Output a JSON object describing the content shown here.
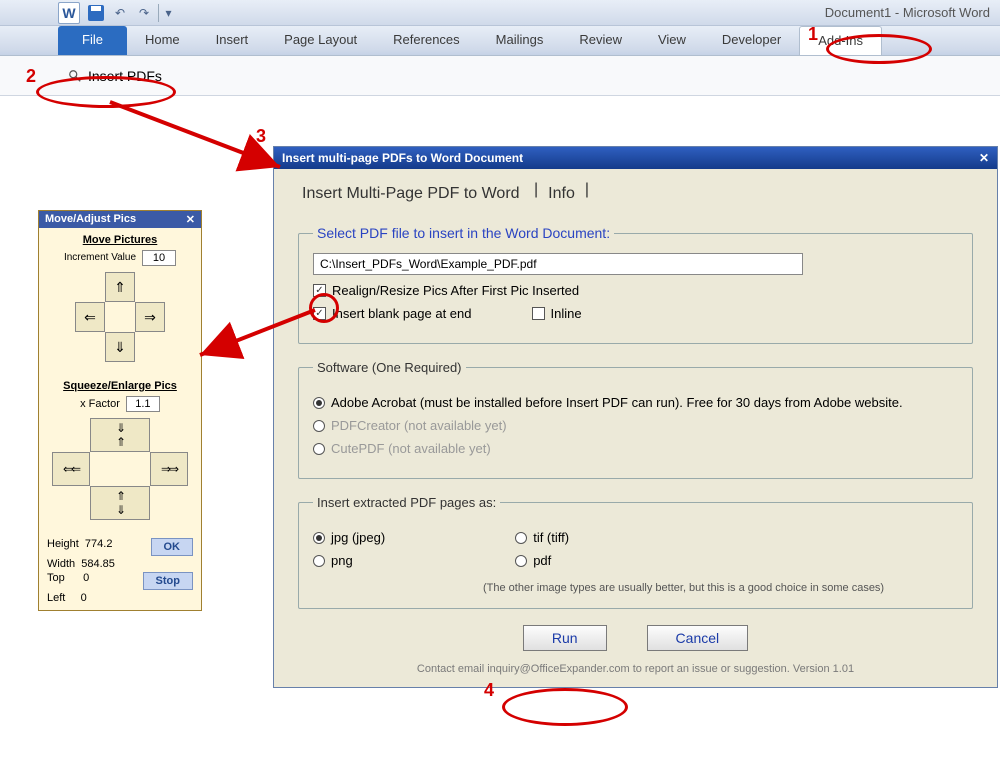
{
  "app": {
    "title": "Document1  -  Microsoft Word"
  },
  "ribbon": {
    "tabs": [
      "File",
      "Home",
      "Insert",
      "Page Layout",
      "References",
      "Mailings",
      "Review",
      "View",
      "Developer",
      "Add-Ins"
    ],
    "active": "Add-Ins",
    "addin_button": "Insert PDFs"
  },
  "move_panel": {
    "title": "Move/Adjust Pics",
    "section1": "Move Pictures",
    "inc_label": "Increment Value",
    "inc_value": "10",
    "section2": "Squeeze/Enlarge Pics",
    "xfactor_label": "x Factor",
    "xfactor_value": "1.1",
    "stats": {
      "height_l": "Height",
      "height_v": "774.2",
      "width_l": "Width",
      "width_v": "584.85",
      "top_l": "Top",
      "top_v": "0",
      "left_l": "Left",
      "left_v": "0"
    },
    "ok": "OK",
    "stop": "Stop"
  },
  "dialog": {
    "title": "Insert multi-page PDFs to Word Document",
    "tab_main": "Insert Multi-Page PDF to Word",
    "tab_info": "Info",
    "select_legend": "Select PDF file to insert in the Word Document:",
    "path": "C:\\Insert_PDFs_Word\\Example_PDF.pdf",
    "chk_realign": "Realign/Resize Pics After First Pic Inserted",
    "chk_blank": "Insert blank page at end",
    "chk_inline": "Inline",
    "software_legend": "Software (One Required)",
    "opt_acrobat": "Adobe Acrobat (must be installed before Insert PDF can run).  Free for 30 days from Adobe website.",
    "opt_pdfcreator": "PDFCreator (not available yet)",
    "opt_cutepdf": "CutePDF (not available yet)",
    "extract_legend": "Insert extracted PDF pages as:",
    "opt_jpg": "jpg (jpeg)",
    "opt_tif": "tif (tiff)",
    "opt_png": "png",
    "opt_pdf": "pdf",
    "extract_note": "(The other image types are usually better, but this is a good choice in some cases)",
    "run": "Run",
    "cancel": "Cancel",
    "footer": "Contact email inquiry@OfficeExpander.com to report an issue or suggestion.   Version 1.01"
  },
  "annotations": {
    "n1": "1",
    "n2": "2",
    "n3": "3",
    "n4": "4"
  }
}
